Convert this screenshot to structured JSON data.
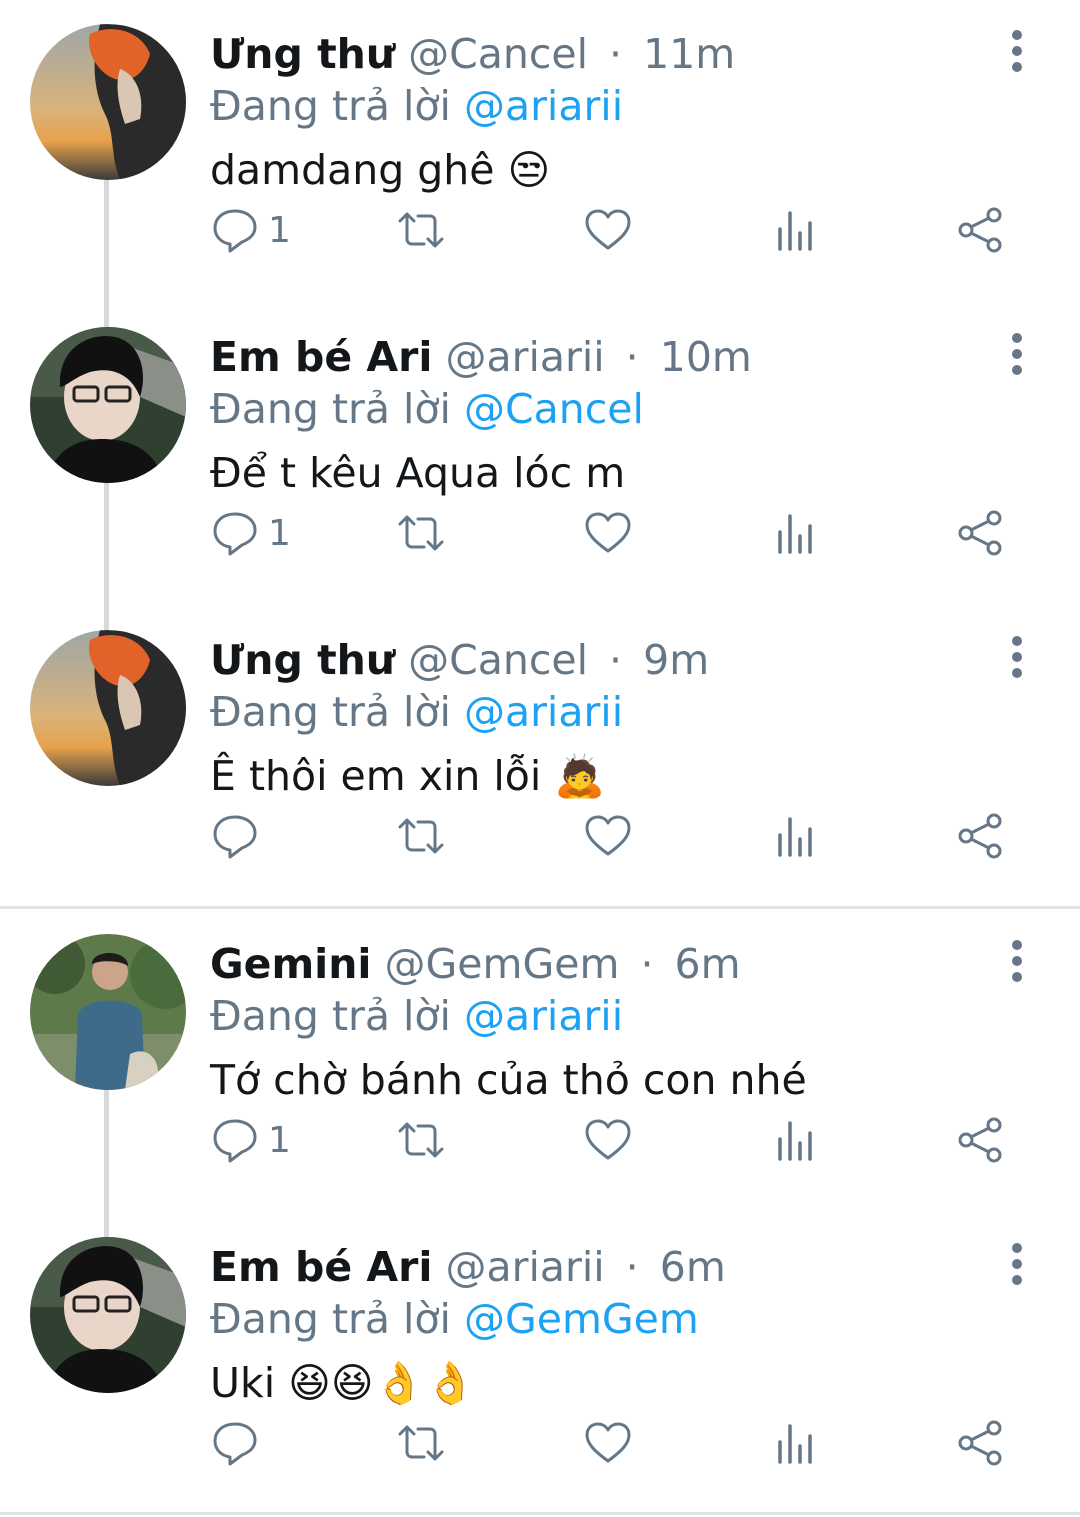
{
  "reply_prefix": "Đang trả lời",
  "tweets": [
    {
      "name": "Ưng thư",
      "handle": "@Cancel",
      "time": "11m",
      "reply_to": "@ariarii",
      "text": "damdang ghê 😒",
      "reply_count": "1",
      "avatar": "sunset-orange-hair"
    },
    {
      "name": "Em bé Ari",
      "handle": "@ariarii",
      "time": "10m",
      "reply_to": "@Cancel",
      "text": "Để t kêu Aqua lóc m",
      "reply_count": "1",
      "avatar": "glasses-boy"
    },
    {
      "name": "Ưng thư",
      "handle": "@Cancel",
      "time": "9m",
      "reply_to": "@ariarii",
      "text": "Ê thôi em xin lỗi 🙇",
      "reply_count": "",
      "avatar": "sunset-orange-hair"
    },
    {
      "name": "Gemini",
      "handle": "@GemGem",
      "time": "6m",
      "reply_to": "@ariarii",
      "text": "Tớ chờ bánh của thỏ con nhé",
      "reply_count": "1",
      "avatar": "outdoor-man"
    },
    {
      "name": "Em bé Ari",
      "handle": "@ariarii",
      "time": "6m",
      "reply_to": "@GemGem",
      "text": "Uki 😆😆👌👌",
      "reply_count": "",
      "avatar": "glasses-boy"
    }
  ],
  "colors": {
    "mention": "#1da1f2",
    "secondary_text": "#657786",
    "thread_line": "#d6dadd"
  },
  "icons": [
    "reply-icon",
    "retweet-icon",
    "like-icon",
    "analytics-icon",
    "share-icon",
    "more-options-icon"
  ]
}
